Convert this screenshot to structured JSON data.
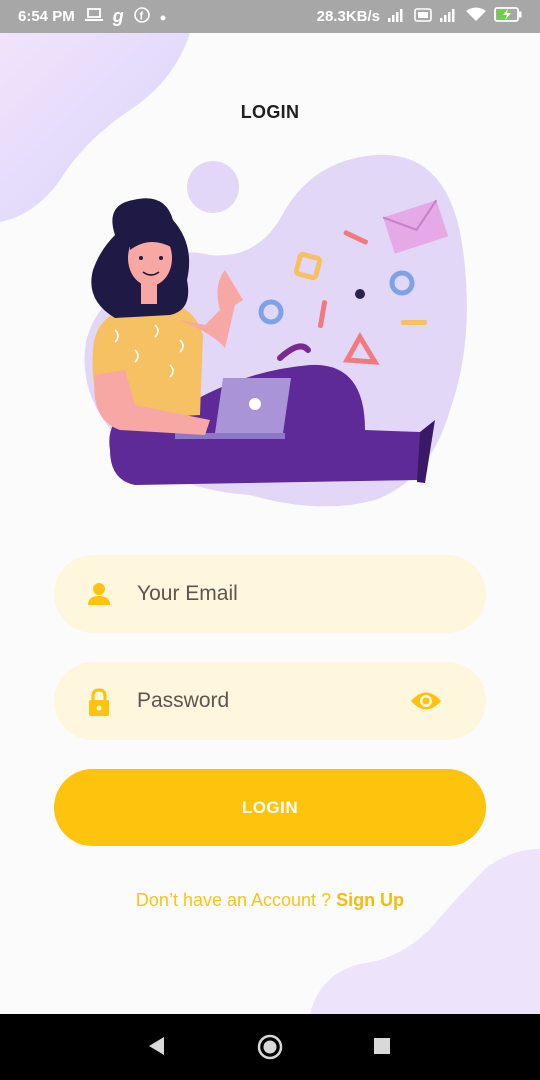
{
  "status_bar": {
    "time": "6:54 PM",
    "network_speed": "28.3KB/s",
    "icons": [
      "laptop-icon",
      "g-icon",
      "facebook-icon",
      "dot-icon",
      "signal-icon",
      "volte-icon",
      "signal-icon",
      "wifi-icon",
      "battery-charging-icon"
    ]
  },
  "page": {
    "title": "LOGIN"
  },
  "form": {
    "email_placeholder": "Your Email",
    "password_placeholder": "Password",
    "login_label": "LOGIN",
    "signup_prompt": "Don’t have an Account ? ",
    "signup_link": "Sign Up"
  },
  "colors": {
    "accent": "#fec30c",
    "field_bg": "#fff6de",
    "blob": "#e3d7f7",
    "purple": "#5e2a97"
  },
  "nav_bar": {
    "icons": [
      "back-icon",
      "home-icon",
      "recents-icon"
    ]
  }
}
